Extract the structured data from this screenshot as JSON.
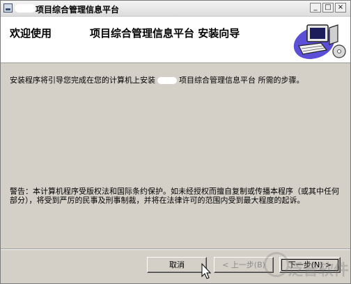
{
  "window": {
    "title": "项目综合管理信息平台",
    "controls": {
      "minimize": "_",
      "maximize": "□",
      "close": "×"
    }
  },
  "header": {
    "welcome": "欢迎使用",
    "wizard_title": "项目综合管理信息平台  安装向导",
    "icon": "computer-icon"
  },
  "body": {
    "intro_before": "安装程序将引导您完成在您的计算机上安装",
    "intro_after": "项目综合管理信息平台 所需的步骤。",
    "warning": "警告：本计算机程序受版权法和国际条约保护。如未经授权而擅自复制或传播本程序（或其中任何部分），将受到严厉的民事及刑事制裁，并将在法律许可的范围内受到最大程度的起诉。"
  },
  "buttons": {
    "cancel": "取消",
    "back": "< 上一步(B)",
    "next": "下一步(N) >"
  },
  "watermark": "泛普软件"
}
